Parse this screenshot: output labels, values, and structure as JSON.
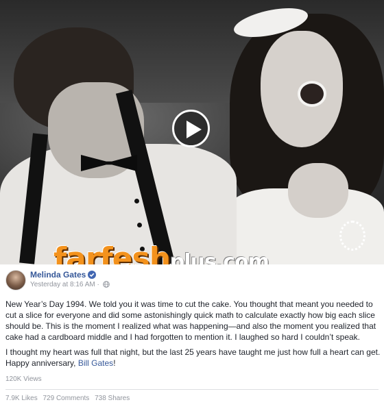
{
  "media": {
    "photo_description": "black and white wedding photograph",
    "watermark_main": "farfesh",
    "watermark_sub": "plus.com"
  },
  "post": {
    "author": "Melinda Gates",
    "verified": true,
    "timestamp": "Yesterday at 8:16 AM",
    "paragraph1": "New Year’s Day 1994. We told you it was time to cut the cake. You thought that meant you needed to cut a slice for everyone and did some astonishingly quick math to calculate exactly how big each slice should be. This is the moment I realized what was happening—and also the moment you realized that cake had a cardboard middle and I had forgotten to mention it. I laughed so hard I couldn’t speak.",
    "paragraph2_prefix": "I thought my heart was full that night, but the last 25 years have taught me just how full a heart can get. Happy anniversary, ",
    "paragraph2_tag": "Bill Gates",
    "paragraph2_suffix": "!"
  },
  "stats": {
    "views": "120K Views",
    "likes": "7.9K Likes",
    "comments": "729 Comments",
    "shares": "738 Shares"
  },
  "colors": {
    "link": "#365899",
    "muted": "#90949c",
    "watermark_orange": "#f3921d"
  }
}
